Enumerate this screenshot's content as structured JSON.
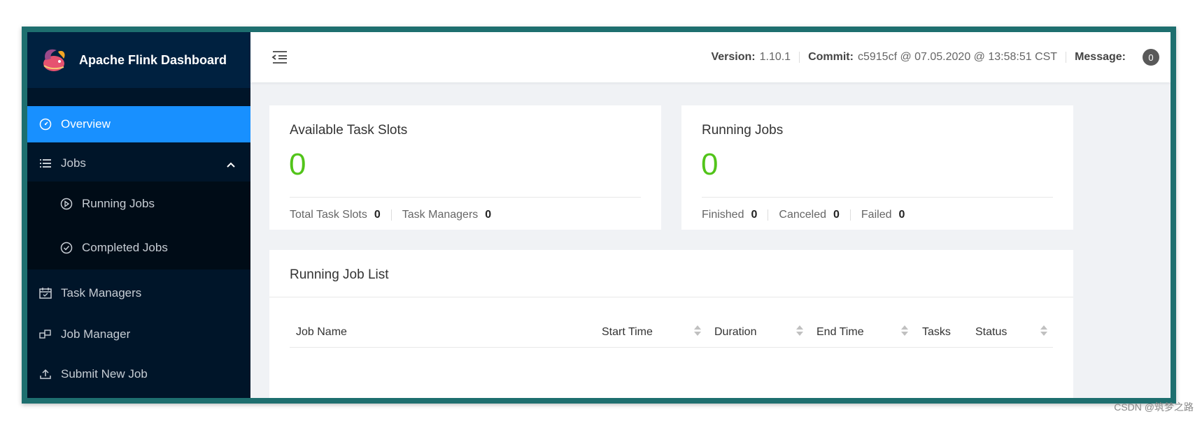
{
  "app": {
    "title": "Apache Flink Dashboard"
  },
  "sidebar": {
    "items": [
      {
        "label": "Overview",
        "icon": "dashboard-icon",
        "active": true
      },
      {
        "label": "Jobs",
        "icon": "list-icon",
        "expanded": true,
        "children": [
          {
            "label": "Running Jobs",
            "icon": "play-circle-icon"
          },
          {
            "label": "Completed Jobs",
            "icon": "check-circle-icon"
          }
        ]
      },
      {
        "label": "Task Managers",
        "icon": "schedule-icon"
      },
      {
        "label": "Job Manager",
        "icon": "cluster-icon"
      },
      {
        "label": "Submit New Job",
        "icon": "upload-icon"
      }
    ]
  },
  "header": {
    "version_label": "Version:",
    "version": "1.10.1",
    "commit_label": "Commit:",
    "commit": "c5915cf @ 07.05.2020 @ 13:58:51 CST",
    "message_label": "Message:",
    "message_count": "0"
  },
  "cards": {
    "slots": {
      "title": "Available Task Slots",
      "value": "0",
      "stats": [
        {
          "label": "Total Task Slots",
          "value": "0"
        },
        {
          "label": "Task Managers",
          "value": "0"
        }
      ]
    },
    "jobs": {
      "title": "Running Jobs",
      "value": "0",
      "stats": [
        {
          "label": "Finished",
          "value": "0"
        },
        {
          "label": "Canceled",
          "value": "0"
        },
        {
          "label": "Failed",
          "value": "0"
        }
      ]
    }
  },
  "job_list": {
    "title": "Running Job List",
    "columns": [
      "Job Name",
      "Start Time",
      "Duration",
      "End Time",
      "Tasks",
      "Status"
    ]
  },
  "watermark": "CSDN @筑梦之路",
  "colors": {
    "sidebar": "#001529",
    "active": "#1890ff",
    "success": "#52c41a",
    "frame": "#1e6f6f"
  }
}
